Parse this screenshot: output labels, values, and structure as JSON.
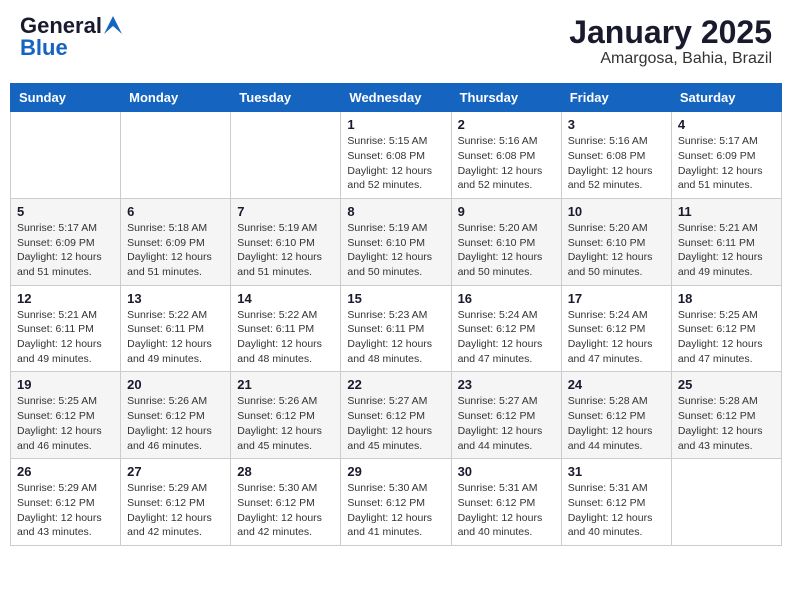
{
  "header": {
    "logo_general": "General",
    "logo_blue": "Blue",
    "month_title": "January 2025",
    "location": "Amargosa, Bahia, Brazil"
  },
  "days_of_week": [
    "Sunday",
    "Monday",
    "Tuesday",
    "Wednesday",
    "Thursday",
    "Friday",
    "Saturday"
  ],
  "weeks": [
    [
      {
        "day": "",
        "info": ""
      },
      {
        "day": "",
        "info": ""
      },
      {
        "day": "",
        "info": ""
      },
      {
        "day": "1",
        "info": "Sunrise: 5:15 AM\nSunset: 6:08 PM\nDaylight: 12 hours\nand 52 minutes."
      },
      {
        "day": "2",
        "info": "Sunrise: 5:16 AM\nSunset: 6:08 PM\nDaylight: 12 hours\nand 52 minutes."
      },
      {
        "day": "3",
        "info": "Sunrise: 5:16 AM\nSunset: 6:08 PM\nDaylight: 12 hours\nand 52 minutes."
      },
      {
        "day": "4",
        "info": "Sunrise: 5:17 AM\nSunset: 6:09 PM\nDaylight: 12 hours\nand 51 minutes."
      }
    ],
    [
      {
        "day": "5",
        "info": "Sunrise: 5:17 AM\nSunset: 6:09 PM\nDaylight: 12 hours\nand 51 minutes."
      },
      {
        "day": "6",
        "info": "Sunrise: 5:18 AM\nSunset: 6:09 PM\nDaylight: 12 hours\nand 51 minutes."
      },
      {
        "day": "7",
        "info": "Sunrise: 5:19 AM\nSunset: 6:10 PM\nDaylight: 12 hours\nand 51 minutes."
      },
      {
        "day": "8",
        "info": "Sunrise: 5:19 AM\nSunset: 6:10 PM\nDaylight: 12 hours\nand 50 minutes."
      },
      {
        "day": "9",
        "info": "Sunrise: 5:20 AM\nSunset: 6:10 PM\nDaylight: 12 hours\nand 50 minutes."
      },
      {
        "day": "10",
        "info": "Sunrise: 5:20 AM\nSunset: 6:10 PM\nDaylight: 12 hours\nand 50 minutes."
      },
      {
        "day": "11",
        "info": "Sunrise: 5:21 AM\nSunset: 6:11 PM\nDaylight: 12 hours\nand 49 minutes."
      }
    ],
    [
      {
        "day": "12",
        "info": "Sunrise: 5:21 AM\nSunset: 6:11 PM\nDaylight: 12 hours\nand 49 minutes."
      },
      {
        "day": "13",
        "info": "Sunrise: 5:22 AM\nSunset: 6:11 PM\nDaylight: 12 hours\nand 49 minutes."
      },
      {
        "day": "14",
        "info": "Sunrise: 5:22 AM\nSunset: 6:11 PM\nDaylight: 12 hours\nand 48 minutes."
      },
      {
        "day": "15",
        "info": "Sunrise: 5:23 AM\nSunset: 6:11 PM\nDaylight: 12 hours\nand 48 minutes."
      },
      {
        "day": "16",
        "info": "Sunrise: 5:24 AM\nSunset: 6:12 PM\nDaylight: 12 hours\nand 47 minutes."
      },
      {
        "day": "17",
        "info": "Sunrise: 5:24 AM\nSunset: 6:12 PM\nDaylight: 12 hours\nand 47 minutes."
      },
      {
        "day": "18",
        "info": "Sunrise: 5:25 AM\nSunset: 6:12 PM\nDaylight: 12 hours\nand 47 minutes."
      }
    ],
    [
      {
        "day": "19",
        "info": "Sunrise: 5:25 AM\nSunset: 6:12 PM\nDaylight: 12 hours\nand 46 minutes."
      },
      {
        "day": "20",
        "info": "Sunrise: 5:26 AM\nSunset: 6:12 PM\nDaylight: 12 hours\nand 46 minutes."
      },
      {
        "day": "21",
        "info": "Sunrise: 5:26 AM\nSunset: 6:12 PM\nDaylight: 12 hours\nand 45 minutes."
      },
      {
        "day": "22",
        "info": "Sunrise: 5:27 AM\nSunset: 6:12 PM\nDaylight: 12 hours\nand 45 minutes."
      },
      {
        "day": "23",
        "info": "Sunrise: 5:27 AM\nSunset: 6:12 PM\nDaylight: 12 hours\nand 44 minutes."
      },
      {
        "day": "24",
        "info": "Sunrise: 5:28 AM\nSunset: 6:12 PM\nDaylight: 12 hours\nand 44 minutes."
      },
      {
        "day": "25",
        "info": "Sunrise: 5:28 AM\nSunset: 6:12 PM\nDaylight: 12 hours\nand 43 minutes."
      }
    ],
    [
      {
        "day": "26",
        "info": "Sunrise: 5:29 AM\nSunset: 6:12 PM\nDaylight: 12 hours\nand 43 minutes."
      },
      {
        "day": "27",
        "info": "Sunrise: 5:29 AM\nSunset: 6:12 PM\nDaylight: 12 hours\nand 42 minutes."
      },
      {
        "day": "28",
        "info": "Sunrise: 5:30 AM\nSunset: 6:12 PM\nDaylight: 12 hours\nand 42 minutes."
      },
      {
        "day": "29",
        "info": "Sunrise: 5:30 AM\nSunset: 6:12 PM\nDaylight: 12 hours\nand 41 minutes."
      },
      {
        "day": "30",
        "info": "Sunrise: 5:31 AM\nSunset: 6:12 PM\nDaylight: 12 hours\nand 40 minutes."
      },
      {
        "day": "31",
        "info": "Sunrise: 5:31 AM\nSunset: 6:12 PM\nDaylight: 12 hours\nand 40 minutes."
      },
      {
        "day": "",
        "info": ""
      }
    ]
  ]
}
